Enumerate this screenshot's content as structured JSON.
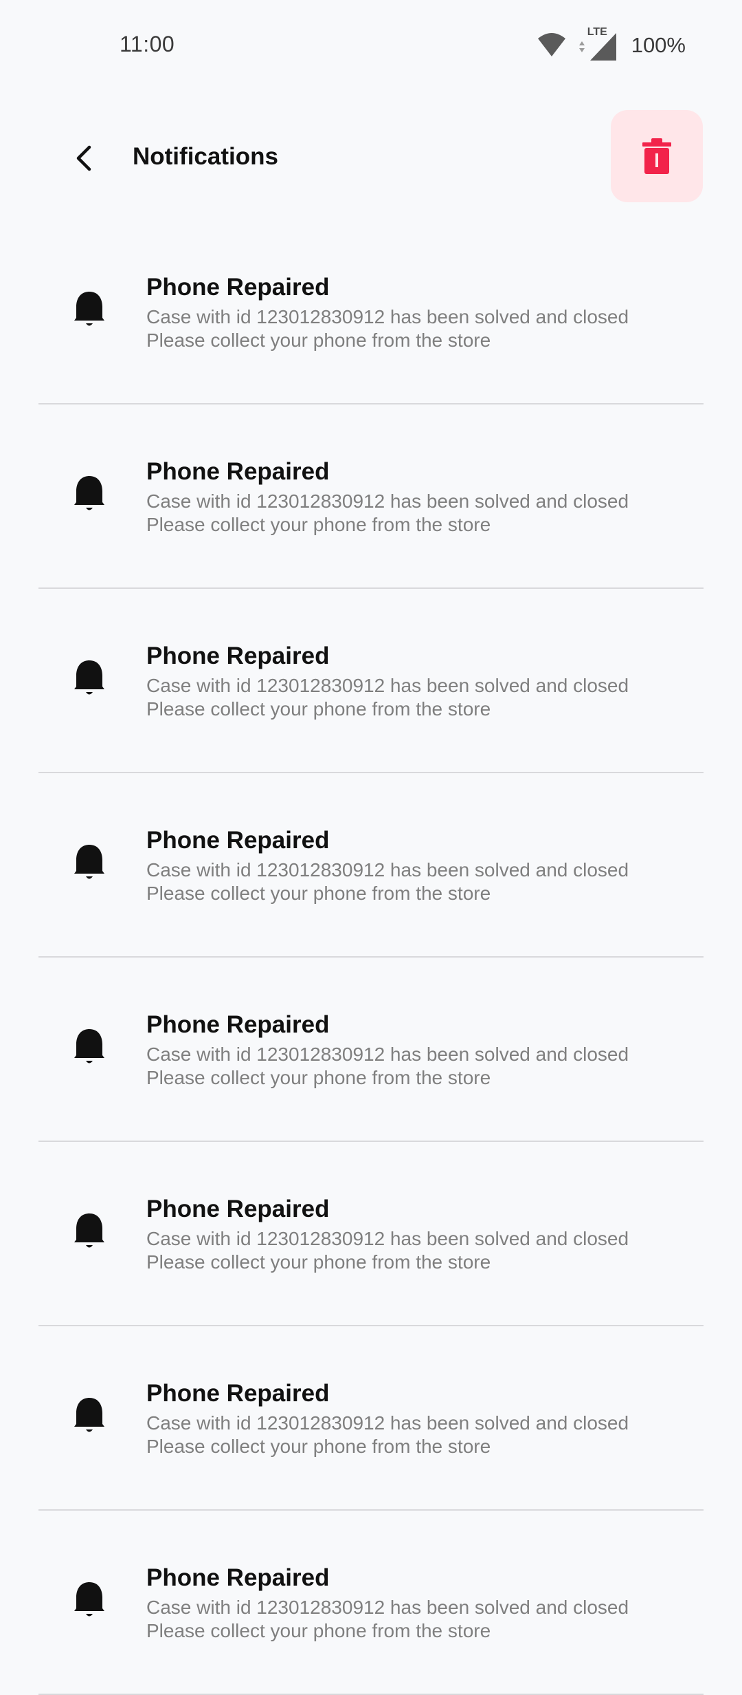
{
  "status_bar": {
    "time": "11:00",
    "network": "LTE",
    "battery": "100%"
  },
  "header": {
    "title": "Notifications",
    "back_icon": "chevron-left-icon",
    "delete_icon": "trash-icon"
  },
  "colors": {
    "background": "#f8f9fb",
    "delete_button_bg": "#ffe6e9",
    "delete_icon": "#f2234a",
    "title_text": "#111111",
    "message_text": "#7f7f7f",
    "divider": "#d9d9dc"
  },
  "notifications": [
    {
      "icon": "bell-icon",
      "title": "Phone Repaired",
      "line1": "Case with id 123012830912 has been solved and closed",
      "line2": "Please collect your phone from the store"
    },
    {
      "icon": "bell-icon",
      "title": "Phone Repaired",
      "line1": "Case with id 123012830912 has been solved and closed",
      "line2": "Please collect your phone from the store"
    },
    {
      "icon": "bell-icon",
      "title": "Phone Repaired",
      "line1": "Case with id 123012830912 has been solved and closed",
      "line2": "Please collect your phone from the store"
    },
    {
      "icon": "bell-icon",
      "title": "Phone Repaired",
      "line1": "Case with id 123012830912 has been solved and closed",
      "line2": "Please collect your phone from the store"
    },
    {
      "icon": "bell-icon",
      "title": "Phone Repaired",
      "line1": "Case with id 123012830912 has been solved and closed",
      "line2": "Please collect your phone from the store"
    },
    {
      "icon": "bell-icon",
      "title": "Phone Repaired",
      "line1": "Case with id 123012830912 has been solved and closed",
      "line2": "Please collect your phone from the store"
    },
    {
      "icon": "bell-icon",
      "title": "Phone Repaired",
      "line1": "Case with id 123012830912 has been solved and closed",
      "line2": "Please collect your phone from the store"
    },
    {
      "icon": "bell-icon",
      "title": "Phone Repaired",
      "line1": "Case with id 123012830912 has been solved and closed",
      "line2": "Please collect your phone from the store"
    }
  ]
}
